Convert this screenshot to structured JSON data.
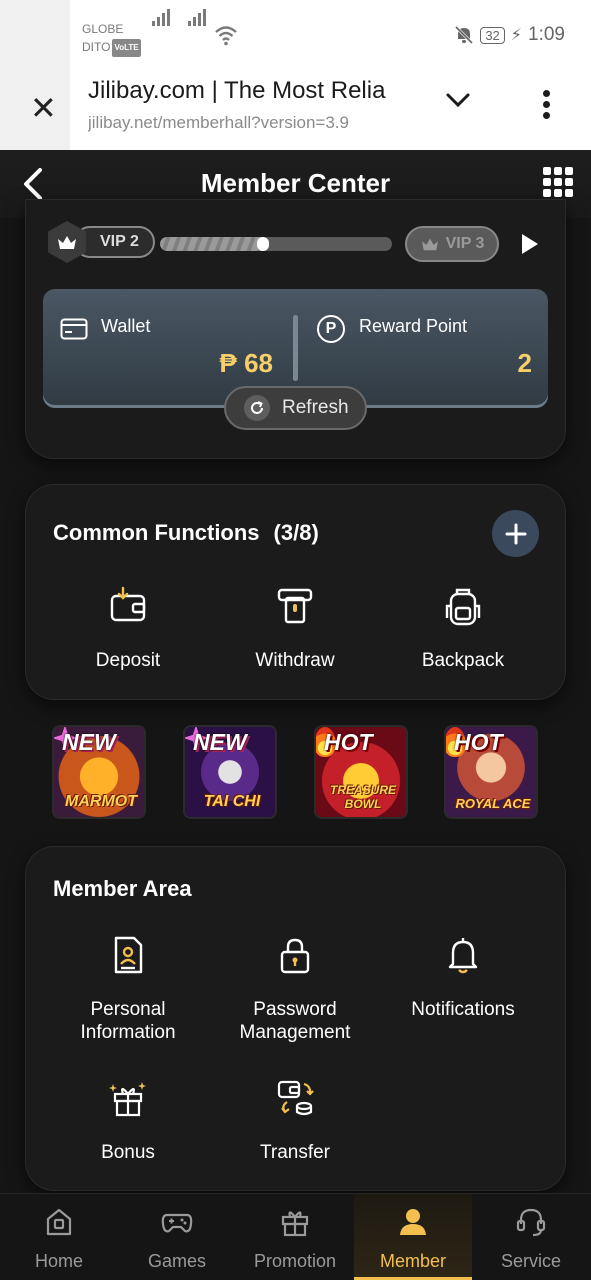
{
  "status_bar": {
    "carrier_line1": "GLOBE",
    "carrier_line2": "DITO",
    "volte": "VoLTE",
    "battery": "32",
    "time": "1:09"
  },
  "browser": {
    "tab_title": "Jilibay.com | The Most Relia",
    "url": "jilibay.net/memberhall?version=3.9",
    "close_icon": "close-icon",
    "dropdown_icon": "chevron-down-icon",
    "more_icon": "more-vert-icon"
  },
  "header": {
    "title": "Member Center",
    "back_icon": "chevron-left-icon",
    "menu_icon": "grid-icon"
  },
  "vip": {
    "current_level": "VIP 2",
    "next_level": "VIP 3",
    "progress": 0.47
  },
  "wallet": {
    "label": "Wallet",
    "amount": "₱ 68"
  },
  "reward": {
    "icon_letter": "P",
    "label": "Reward Point",
    "points": "2"
  },
  "refresh_label": "Refresh",
  "common_functions": {
    "title": "Common Functions",
    "count": "(3/8)",
    "items": [
      {
        "label": "Deposit",
        "icon": "deposit-icon"
      },
      {
        "label": "Withdraw",
        "icon": "withdraw-icon"
      },
      {
        "label": "Backpack",
        "icon": "backpack-icon"
      }
    ]
  },
  "promos": [
    {
      "badge": "NEW",
      "name": "MARMOT",
      "icon": "game-boom-marmot"
    },
    {
      "badge": "NEW",
      "name": "TAI CHI",
      "icon": "game-tai-chi"
    },
    {
      "badge": "HOT",
      "name": "TREASURE BOWL",
      "icon": "game-treasure-bowl"
    },
    {
      "badge": "HOT",
      "name": "ROYAL ACE",
      "icon": "game-royal-ace"
    }
  ],
  "member_area": {
    "title": "Member Area",
    "items": [
      {
        "label": "Personal Information",
        "icon": "personal-info-icon"
      },
      {
        "label": "Password Management",
        "icon": "lock-icon"
      },
      {
        "label": "Notifications",
        "icon": "bell-icon"
      },
      {
        "label": "Bonus",
        "icon": "gift-icon"
      },
      {
        "label": "Transfer",
        "icon": "transfer-icon"
      }
    ]
  },
  "bottom_nav": {
    "active": "Member",
    "items": [
      {
        "label": "Home",
        "icon": "home-icon"
      },
      {
        "label": "Games",
        "icon": "gamepad-icon"
      },
      {
        "label": "Promotion",
        "icon": "gift-icon"
      },
      {
        "label": "Member",
        "icon": "user-icon"
      },
      {
        "label": "Service",
        "icon": "headset-icon"
      }
    ]
  },
  "colors": {
    "accent_gold": "#f3c04f",
    "amount_gold": "#f6cf6b",
    "background": "#151515",
    "card": "#1b1b1b",
    "wallet_panel": "#3a4650"
  }
}
